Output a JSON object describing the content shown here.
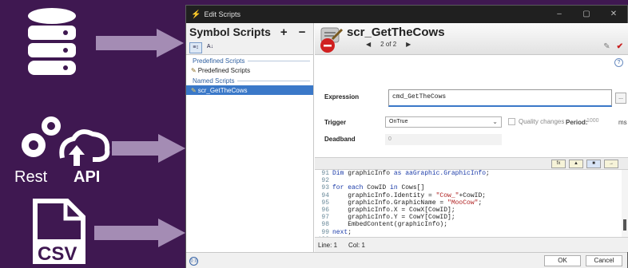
{
  "window": {
    "title": "Edit Scripts",
    "controls": [
      "–",
      "▢",
      "✕"
    ]
  },
  "left_pane": {
    "title": "Symbol Scripts",
    "add": "+",
    "remove": "−",
    "sort_a": "≡↕",
    "sort_b": "A↓",
    "groups": [
      {
        "label": "Predefined Scripts",
        "items": [
          "Predefined Scripts"
        ]
      },
      {
        "label": "Named Scripts",
        "items": [
          "scr_GetTheCows"
        ]
      }
    ]
  },
  "script_header": {
    "name": "scr_GetTheCows",
    "prev": "◀",
    "page": "2 of 2",
    "next": "▶"
  },
  "properties": {
    "help": "?",
    "expression_label": "Expression",
    "expression_value": "cmd_GetTheCows",
    "dots": "...",
    "trigger_label": "Trigger",
    "trigger_value": "OnTrue",
    "quality_label": "Quality changes",
    "period_label": "Period:",
    "period_value": "1000",
    "period_unit": "ms",
    "deadband_label": "Deadband",
    "deadband_value": "0"
  },
  "editor_tools": [
    "fx",
    "▲",
    "■",
    "→"
  ],
  "code_lines": [
    {
      "n": "91",
      "parts": [
        [
          "kw",
          "Dim "
        ],
        [
          "tx",
          "graphicInfo "
        ],
        [
          "kw",
          "as "
        ],
        [
          "ty",
          "aaGraphic.GraphicInfo"
        ],
        [
          "tx",
          ";"
        ]
      ]
    },
    {
      "n": "92",
      "parts": []
    },
    {
      "n": "93",
      "parts": [
        [
          "kw",
          "for each "
        ],
        [
          "tx",
          "CowID "
        ],
        [
          "kw",
          "in "
        ],
        [
          "tx",
          "Cows[]"
        ]
      ]
    },
    {
      "n": "94",
      "parts": [
        [
          "tx",
          "    graphicInfo.Identity = "
        ],
        [
          "str",
          "\"Cow_\""
        ],
        [
          "tx",
          "+CowID;"
        ]
      ]
    },
    {
      "n": "95",
      "parts": [
        [
          "tx",
          "    graphicInfo.GraphicName = "
        ],
        [
          "str",
          "\"MooCow\""
        ],
        [
          "tx",
          ";"
        ]
      ]
    },
    {
      "n": "96",
      "parts": [
        [
          "tx",
          "    graphicInfo.X = CowX[CowID];"
        ]
      ]
    },
    {
      "n": "97",
      "parts": [
        [
          "tx",
          "    graphicInfo.Y = CowY[CowID];"
        ]
      ]
    },
    {
      "n": "98",
      "parts": [
        [
          "tx",
          "    EmbedContent(graphicInfo);"
        ]
      ]
    },
    {
      "n": "99",
      "parts": [
        [
          "kw",
          "next"
        ],
        [
          "tx",
          ";"
        ]
      ]
    },
    {
      "n": "100",
      "parts": []
    }
  ],
  "status": {
    "line_label": "Line:",
    "line_value": "1",
    "col_label": "Col:",
    "col_value": "1"
  },
  "bottom": {
    "ok": "OK",
    "cancel": "Cancel",
    "info_icon": "((·))"
  },
  "decor": {
    "rest_label": "Rest",
    "api_label": "API",
    "csv_label": "CSV"
  },
  "colors": {
    "background": "#3f1851",
    "arrow": "#a48cb4",
    "selection": "#3a78c8"
  }
}
